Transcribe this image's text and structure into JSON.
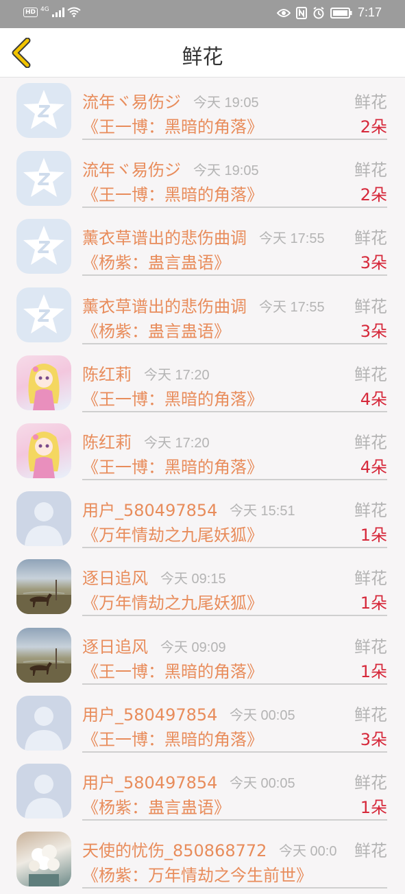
{
  "status_bar": {
    "hd": "HD",
    "network": "4G",
    "time": "7:17",
    "icons": [
      "eye-icon",
      "nfc-icon",
      "alarm-icon",
      "battery-icon"
    ]
  },
  "header": {
    "title": "鲜花",
    "back_icon": "chevron-left-icon"
  },
  "colors": {
    "accent_name": "#e88c5b",
    "count": "#d6283a",
    "muted": "#b4b4b4",
    "back": "#f2c400"
  },
  "gifts": [
    {
      "avatar": "qq",
      "user": "流年ヾ易伤ジ",
      "time": "今天 19:05",
      "type": "鲜花",
      "book": "《王一博：黑暗的角落》",
      "count": "2朵"
    },
    {
      "avatar": "qq",
      "user": "流年ヾ易伤ジ",
      "time": "今天 19:05",
      "type": "鲜花",
      "book": "《王一博：黑暗的角落》",
      "count": "2朵"
    },
    {
      "avatar": "qq",
      "user": "薰衣草谱出的悲伤曲调",
      "time": "今天 17:55",
      "type": "鲜花",
      "book": "《杨紫：蛊言蛊语》",
      "count": "3朵"
    },
    {
      "avatar": "qq",
      "user": "薰衣草谱出的悲伤曲调",
      "time": "今天 17:55",
      "type": "鲜花",
      "book": "《杨紫：蛊言蛊语》",
      "count": "3朵"
    },
    {
      "avatar": "anime",
      "user": "陈红莉",
      "time": "今天 17:20",
      "type": "鲜花",
      "book": "《王一博：黑暗的角落》",
      "count": "4朵"
    },
    {
      "avatar": "anime",
      "user": "陈红莉",
      "time": "今天 17:20",
      "type": "鲜花",
      "book": "《王一博：黑暗的角落》",
      "count": "4朵"
    },
    {
      "avatar": "person",
      "user": "用户_580497854",
      "time": "今天 15:51",
      "type": "鲜花",
      "book": "《万年情劫之九尾妖狐》",
      "count": "1朵"
    },
    {
      "avatar": "horse",
      "user": "逐日追风",
      "time": "今天 09:15",
      "type": "鲜花",
      "book": "《万年情劫之九尾妖狐》",
      "count": "1朵"
    },
    {
      "avatar": "horse",
      "user": "逐日追风",
      "time": "今天 09:09",
      "type": "鲜花",
      "book": "《王一博：黑暗的角落》",
      "count": "1朵"
    },
    {
      "avatar": "person",
      "user": "用户_580497854",
      "time": "今天 00:05",
      "type": "鲜花",
      "book": "《王一博：黑暗的角落》",
      "count": "3朵"
    },
    {
      "avatar": "person",
      "user": "用户_580497854",
      "time": "今天 00:05",
      "type": "鲜花",
      "book": "《杨紫：蛊言蛊语》",
      "count": "1朵"
    },
    {
      "avatar": "flower",
      "user": "天使的忧伤_850868772",
      "time": "今天 00:0",
      "type": "鲜花",
      "book": "《杨紫：万年情劫之今生前世》",
      "count": ""
    }
  ]
}
